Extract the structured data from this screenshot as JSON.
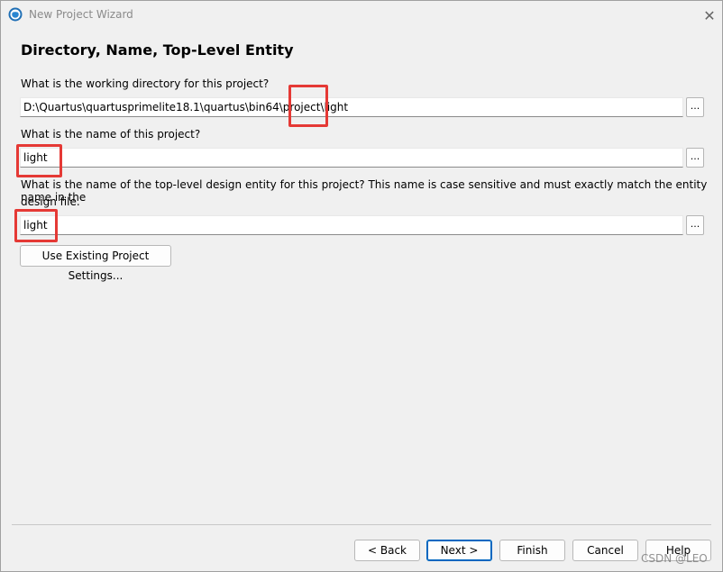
{
  "window": {
    "title": "New Project Wizard",
    "close_glyph": "✕"
  },
  "page": {
    "heading": "Directory, Name, Top-Level Entity"
  },
  "directory": {
    "label": "What is the working directory for this project?",
    "value": "D:\\Quartus\\quartusprimelite18.1\\quartus\\bin64\\project\\light",
    "browse_label": "..."
  },
  "project_name": {
    "label": "What is the name of this project?",
    "value": "light",
    "browse_label": "..."
  },
  "top_entity": {
    "label_line1": "What is the name of the top-level design entity for this project? This name is case sensitive and must exactly match the entity name in the",
    "label_line2": "design file.",
    "value": "light",
    "browse_label": "..."
  },
  "existing_settings_button": "Use Existing Project Settings...",
  "buttons": {
    "back": "< Back",
    "next": "Next >",
    "finish": "Finish",
    "cancel": "Cancel",
    "help": "Help"
  },
  "watermark": "CSDN @LEO",
  "colors": {
    "highlight": "#e53935",
    "default_button_border": "#0067c0"
  },
  "icons": {
    "app": "quartus-globe-icon",
    "close": "close-icon"
  }
}
